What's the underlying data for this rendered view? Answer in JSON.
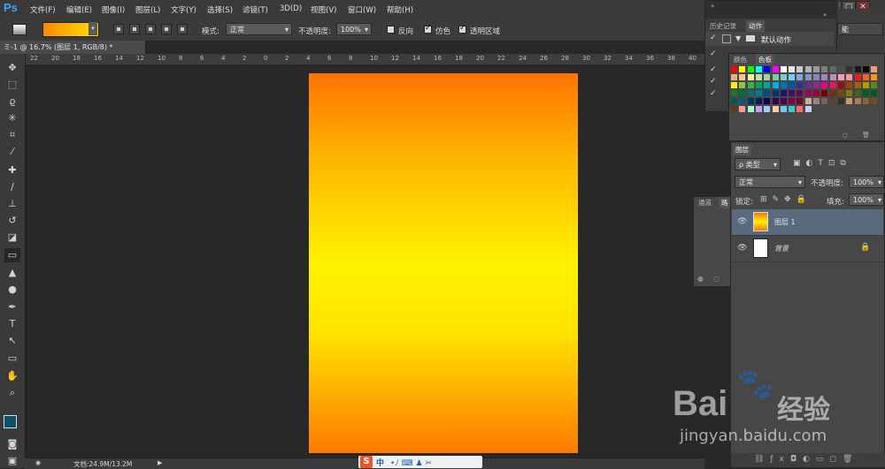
{
  "app": {
    "logo": "Ps"
  },
  "menu": [
    "文件(F)",
    "编辑(E)",
    "图像(I)",
    "图层(L)",
    "文字(Y)",
    "选择(S)",
    "滤镜(T)",
    "3D(D)",
    "视图(V)",
    "窗口(W)",
    "帮助(H)"
  ],
  "window_controls": [
    "–",
    "□",
    "✕"
  ],
  "options": {
    "mode_label": "模式:",
    "mode_value": "正常",
    "opacity_label": "不透明度:",
    "opacity_value": "100%",
    "reverse_label": "反向",
    "dither_label": "仿色",
    "transparency_label": "透明区域",
    "reverse_checked": false,
    "dither_checked": true,
    "transparency_checked": true,
    "gradient_colors": [
      "#ff8a00",
      "#ffe000"
    ]
  },
  "document": {
    "tab_title": "ミ-1 @ 16.7% (图层 1, RGB/8) *",
    "ruler_ticks": [
      "22",
      "20",
      "18",
      "16",
      "14",
      "12",
      "10",
      "8",
      "6",
      "4",
      "2",
      "0",
      "2",
      "4",
      "6",
      "8",
      "10",
      "12",
      "14",
      "16",
      "18",
      "20",
      "22",
      "24",
      "26",
      "28",
      "30",
      "32",
      "34",
      "36",
      "38",
      "40"
    ],
    "status": "文档:24.9M/13.2M",
    "gradient": [
      "#ff7300",
      "#ffb400",
      "#fff200",
      "#ffe400",
      "#ff7a00"
    ]
  },
  "history_panel": {
    "tabs": [
      "历史记录",
      "动作"
    ],
    "items": [
      "默认动作"
    ]
  },
  "swatch_panel": {
    "tabs": [
      "颜色",
      "色板"
    ]
  },
  "channels_panel": {
    "tabs": [
      "通道",
      "路"
    ]
  },
  "layers_panel": {
    "title": "图层",
    "filter_label": "ρ 类型",
    "blend_mode": "正常",
    "opacity_label": "不透明度:",
    "opacity_value": "100%",
    "lock_label": "锁定:",
    "fill_label": "填充:",
    "fill_value": "100%",
    "layers": [
      {
        "name": "图层 1"
      },
      {
        "name": "背景"
      }
    ],
    "right_panel_tab": "能"
  },
  "taskbar": {
    "ime_label": "中"
  },
  "watermark": {
    "brand": "Bai",
    "brand2": "经验",
    "url": "jingyan.baidu.com"
  }
}
